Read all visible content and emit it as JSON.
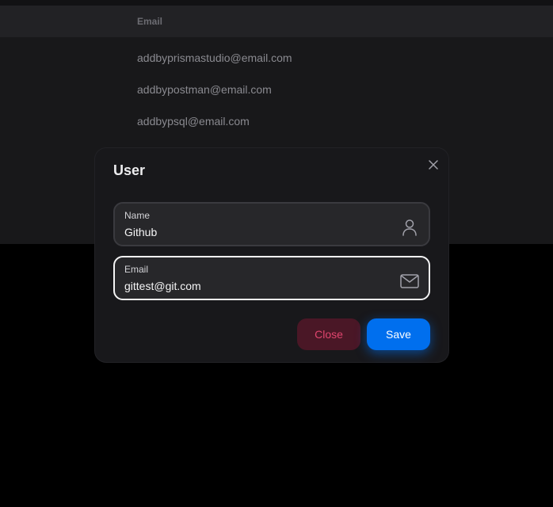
{
  "table": {
    "header": "Email",
    "rows": [
      "addbyprismastudio@email.com",
      "addbypostman@email.com",
      "addbypsql@email.com"
    ]
  },
  "modal": {
    "title": "User",
    "close_icon": "close-icon",
    "name_field": {
      "label": "Name",
      "value": "Github",
      "icon": "user-icon"
    },
    "email_field": {
      "label": "Email",
      "value": "gittest@git.com",
      "icon": "mail-icon"
    },
    "close_label": "Close",
    "save_label": "Save"
  },
  "colors": {
    "primary": "#006fee",
    "danger": "#e0456e",
    "danger_bg": "#4a1726",
    "surface": "#18181b"
  }
}
